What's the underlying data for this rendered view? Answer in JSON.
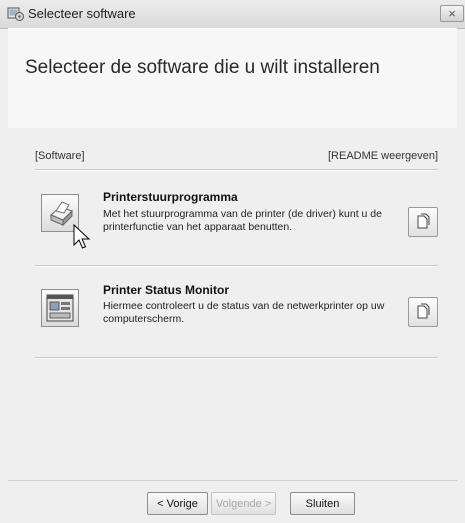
{
  "window": {
    "title": "Selecteer software",
    "close_symbol": "×",
    "title_icon": "setup-icon",
    "close_icon": "close-icon"
  },
  "main": {
    "heading": "Selecteer de software die u wilt installeren",
    "column_left": "[Software]",
    "column_right": "[README weergeven]"
  },
  "items": [
    {
      "title": "Printerstuurprogramma",
      "description": "Met het stuurprogramma van de printer (de driver) kunt u de printerfunctie van het apparaat benutten.",
      "icon": "printer-icon",
      "readme_icon": "document-icon"
    },
    {
      "title": "Printer Status Monitor",
      "description": "Hiermee controleert u de status van de netwerkprinter op uw computerscherm.",
      "icon": "status-monitor-icon",
      "readme_icon": "document-icon"
    }
  ],
  "buttons": {
    "back": "< Vorige",
    "next": "Volgende >",
    "close": "Sluiten"
  },
  "colors": {
    "window_bg": "#efefef",
    "header_bg": "#f7f7f7",
    "disabled_text": "#a8a8a8"
  }
}
